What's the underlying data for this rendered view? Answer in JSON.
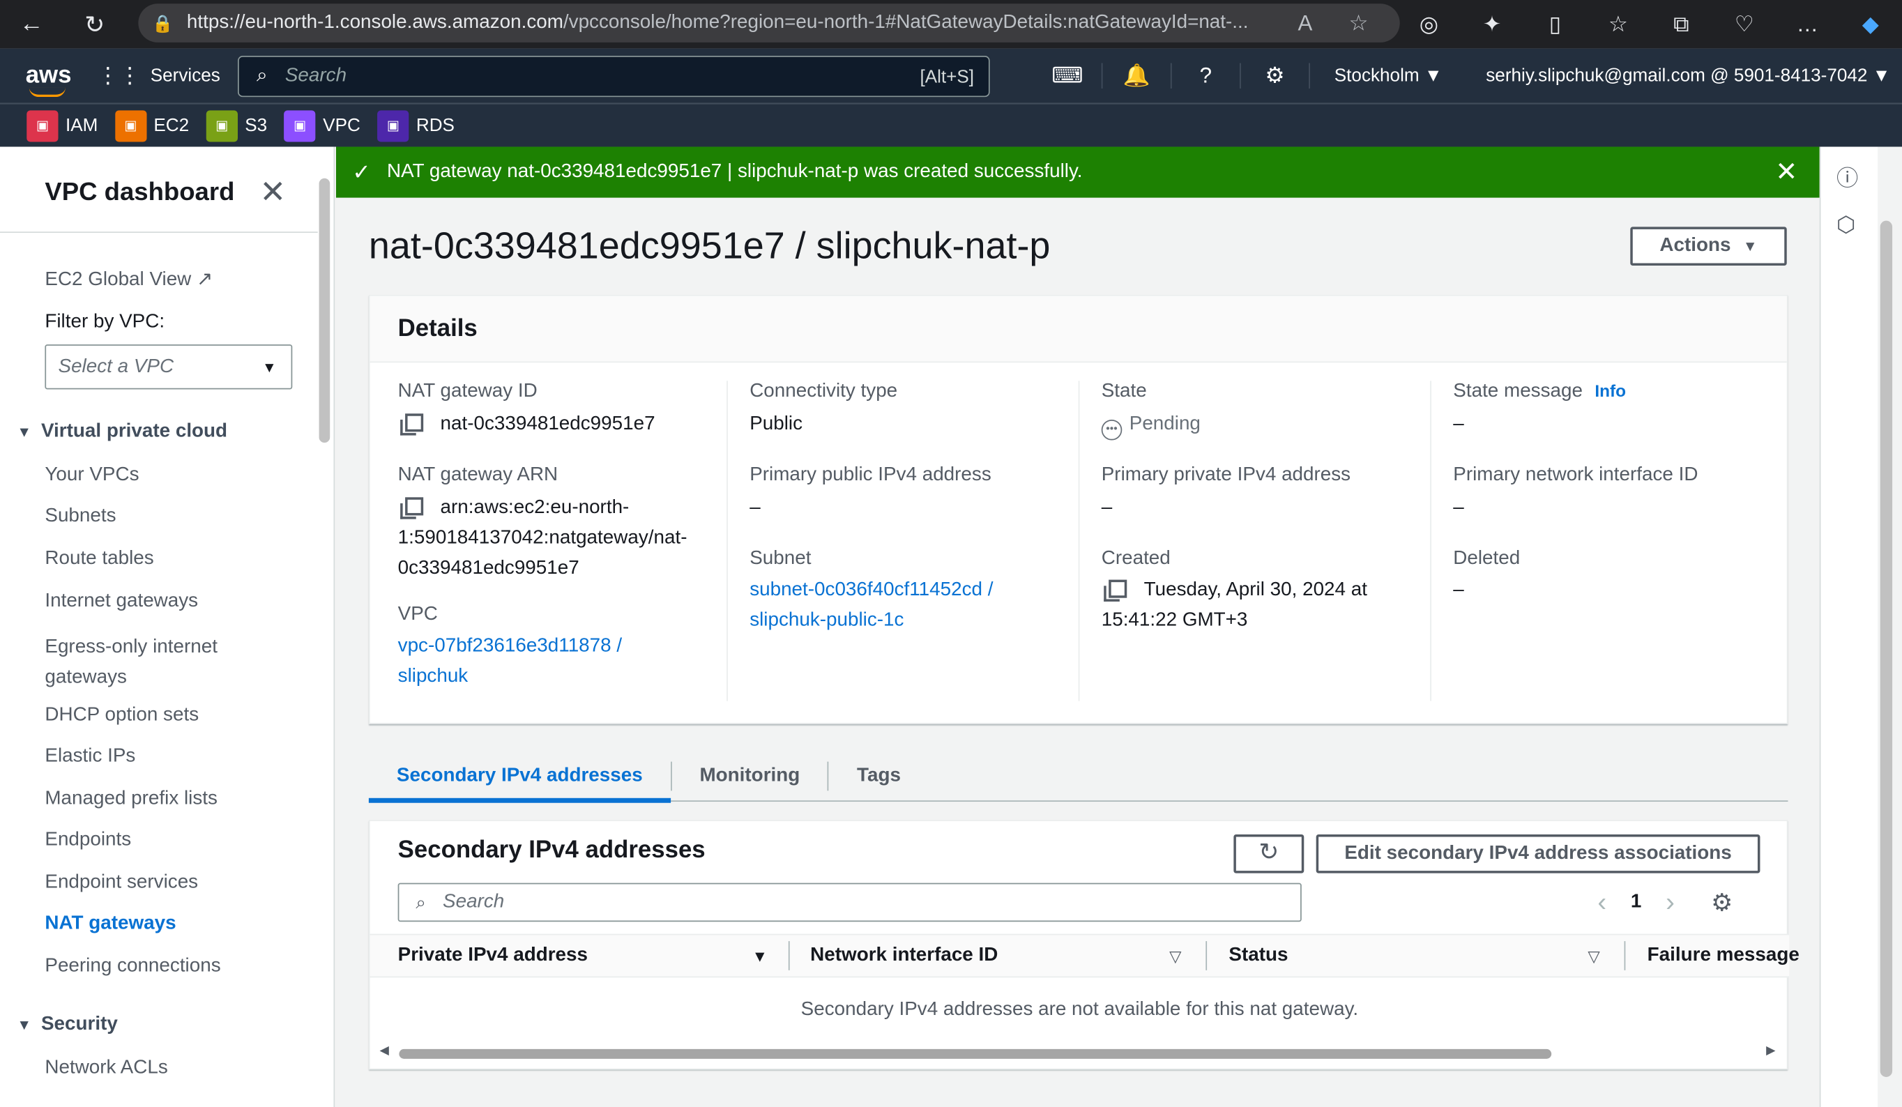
{
  "browser": {
    "url_host": "https://eu-north-1.console.aws.amazon.com",
    "url_path": "/vpcconsole/home?region=eu-north-1#NatGatewayDetails:natGatewayId=nat-..."
  },
  "topnav": {
    "logo": "aws",
    "services_label": "Services",
    "search_placeholder": "Search",
    "search_shortcut": "[Alt+S]",
    "region": "Stockholm ▼",
    "account": "serhiy.slipchuk@gmail.com @ 5901-8413-7042 ▼"
  },
  "favorites": [
    {
      "label": "IAM",
      "color": "#dd344c",
      "icon": "iam-icon"
    },
    {
      "label": "EC2",
      "color": "#ed7100",
      "icon": "ec2-icon"
    },
    {
      "label": "S3",
      "color": "#7aa116",
      "icon": "s3-icon"
    },
    {
      "label": "VPC",
      "color": "#8c4fff",
      "icon": "vpc-icon"
    },
    {
      "label": "RDS",
      "color": "#4d27aa",
      "icon": "rds-icon"
    }
  ],
  "sidebar": {
    "title": "VPC dashboard",
    "ec2_global_view": "EC2 Global View",
    "filter_label": "Filter by VPC:",
    "filter_placeholder": "Select a VPC",
    "section_vpc": "Virtual private cloud",
    "items": [
      "Your VPCs",
      "Subnets",
      "Route tables",
      "Internet gateways",
      "Egress-only internet gateways",
      "DHCP option sets",
      "Elastic IPs",
      "Managed prefix lists",
      "Endpoints",
      "Endpoint services",
      "NAT gateways",
      "Peering connections"
    ],
    "active_item": "NAT gateways",
    "section_security": "Security",
    "security_items": [
      "Network ACLs"
    ]
  },
  "flash": {
    "message": "NAT gateway nat-0c339481edc9951e7 | slipchuk-nat-p was created successfully."
  },
  "page": {
    "title": "nat-0c339481edc9951e7 / slipchuk-nat-p",
    "actions_label": "Actions"
  },
  "details": {
    "heading": "Details",
    "nat_gateway_id_label": "NAT gateway ID",
    "nat_gateway_id": "nat-0c339481edc9951e7",
    "arn_label": "NAT gateway ARN",
    "arn_line1": "arn:aws:ec2:eu-north-",
    "arn_line2": "1:590184137042:natgateway/nat-",
    "arn_line3": "0c339481edc9951e7",
    "vpc_label": "VPC",
    "vpc_line1": "vpc-07bf23616e3d11878 /",
    "vpc_line2": "slipchuk",
    "connectivity_label": "Connectivity type",
    "connectivity": "Public",
    "public_ip_label": "Primary public IPv4 address",
    "public_ip": "–",
    "subnet_label": "Subnet",
    "subnet_line1": "subnet-0c036f40cf11452cd /",
    "subnet_line2": "slipchuk-public-1c",
    "state_label": "State",
    "state": "Pending",
    "private_ip_label": "Primary private IPv4 address",
    "private_ip": "–",
    "created_label": "Created",
    "created_line1": "Tuesday, April 30, 2024 at",
    "created_line2": "15:41:22 GMT+3",
    "state_message_label": "State message",
    "info_label": "Info",
    "state_message": "–",
    "eni_label": "Primary network interface ID",
    "eni": "–",
    "deleted_label": "Deleted",
    "deleted": "–"
  },
  "tabs": [
    "Secondary IPv4 addresses",
    "Monitoring",
    "Tags"
  ],
  "secondary": {
    "title": "Secondary IPv4 addresses",
    "edit_label": "Edit secondary IPv4 address associations",
    "search_placeholder": "Search",
    "page": "1",
    "columns": [
      "Private IPv4 address",
      "Network interface ID",
      "Status",
      "Failure message"
    ],
    "empty_message": "Secondary IPv4 addresses are not available for this nat gateway."
  }
}
